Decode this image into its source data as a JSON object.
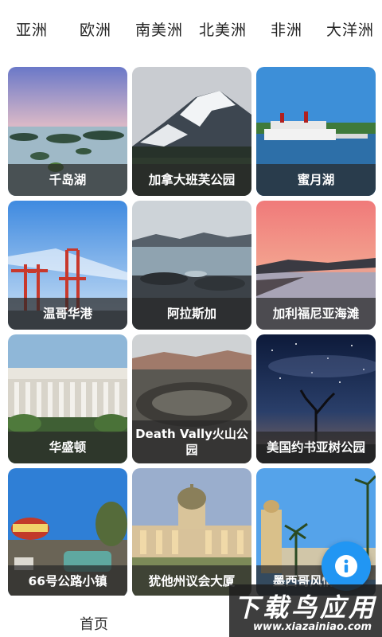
{
  "tabs": [
    "亚洲",
    "欧洲",
    "南美洲",
    "北美洲",
    "非洲",
    "大洋洲"
  ],
  "cards": [
    {
      "title": "千岛湖"
    },
    {
      "title": "加拿大班芙公园"
    },
    {
      "title": "蜜月湖"
    },
    {
      "title": "温哥华港"
    },
    {
      "title": "阿拉斯加"
    },
    {
      "title": "加利福尼亚海滩"
    },
    {
      "title": "华盛顿"
    },
    {
      "title": "Death Vally火山公园"
    },
    {
      "title": "美国约书亚树公园"
    },
    {
      "title": "66号公路小镇"
    },
    {
      "title": "犹他州议会大厦"
    },
    {
      "title": "墨西哥风情小镇"
    }
  ],
  "bottom_nav": {
    "home_label": "首页"
  },
  "fab": {
    "icon": "info-icon",
    "color": "#2196f3"
  },
  "watermark": {
    "text": "下载鸟应用",
    "url": "www.xiazainiao.com"
  }
}
